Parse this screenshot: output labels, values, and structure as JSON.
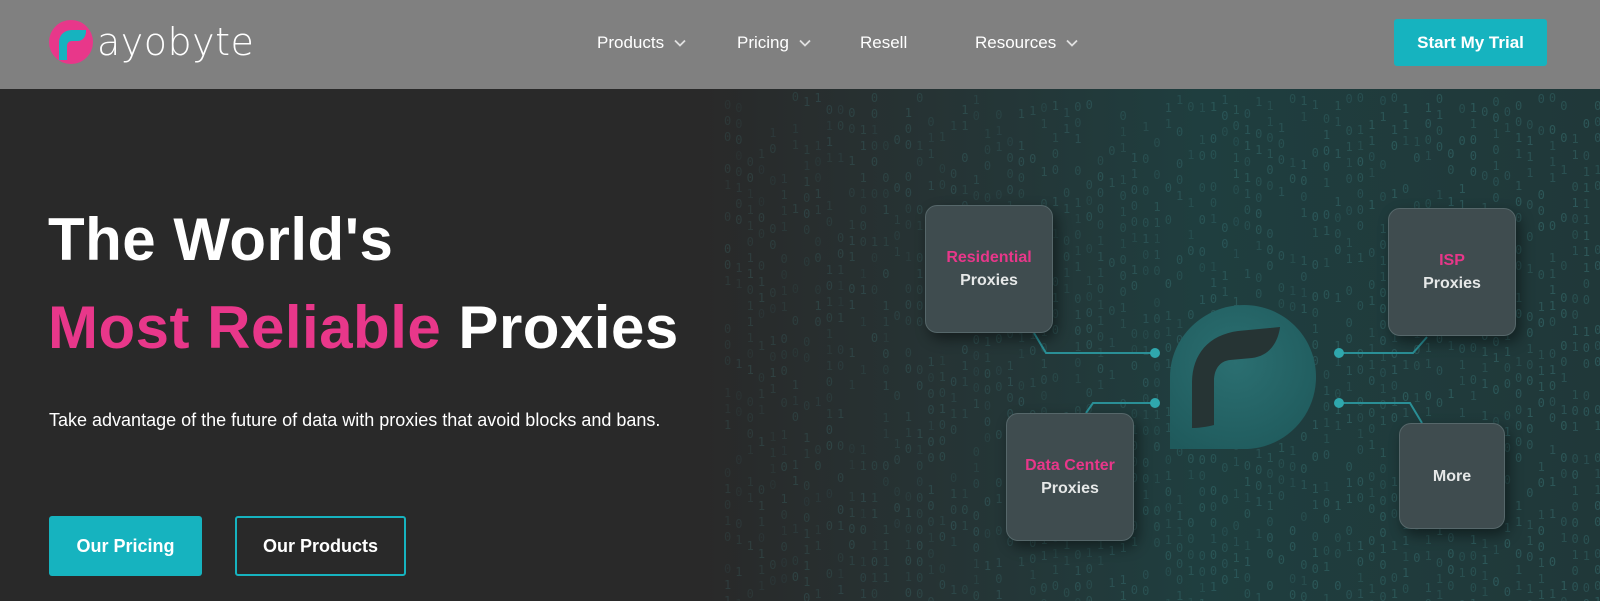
{
  "header": {
    "brand": "ayobyte",
    "nav": [
      {
        "label": "Products",
        "has_dropdown": true
      },
      {
        "label": "Pricing",
        "has_dropdown": true
      },
      {
        "label": "Resell",
        "has_dropdown": false
      },
      {
        "label": "Resources",
        "has_dropdown": true
      }
    ],
    "cta_label": "Start My Trial"
  },
  "hero": {
    "title_line1": "The World's",
    "title_highlight": "Most Reliable",
    "title_rest": "Proxies",
    "subtitle": "Take advantage of the future of data with proxies that avoid blocks and bans.",
    "primary_button": "Our Pricing",
    "secondary_button": "Our Products"
  },
  "diagram": {
    "cards": [
      {
        "accent": "Residential",
        "label": "Proxies"
      },
      {
        "accent": "ISP",
        "label": "Proxies"
      },
      {
        "accent": "Data Center",
        "label": "Proxies"
      },
      {
        "accent": "",
        "label": "More"
      }
    ]
  },
  "colors": {
    "accent_pink": "#e8378a",
    "accent_teal": "#16b3bf",
    "header_bg": "#808080",
    "hero_bg": "#292929"
  },
  "icons": [
    "ayobyte-logo-icon",
    "chevron-down-icon",
    "ayobyte-mark-icon"
  ]
}
